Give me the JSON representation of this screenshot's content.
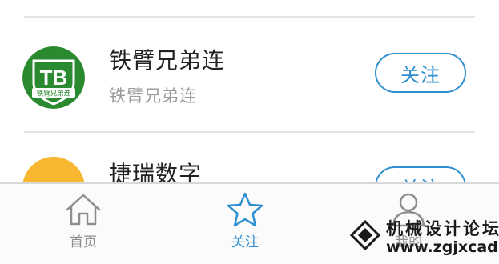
{
  "accounts": [
    {
      "name": "铁臂兄弟连",
      "subtitle": "铁臂兄弟连",
      "follow_label": "关注",
      "avatar": {
        "badge_text": "TB",
        "ribbon_text": "铁臂兄弟连",
        "bg_color": "#2a8a2f"
      }
    },
    {
      "name": "捷瑞数字",
      "follow_label": "关注",
      "avatar": {
        "bg_color": "#f7b731"
      }
    }
  ],
  "tabbar": {
    "tabs": [
      {
        "label": "首页",
        "icon": "home-icon",
        "active": false
      },
      {
        "label": "关注",
        "icon": "star-icon",
        "active": true
      },
      {
        "label": "我的",
        "icon": "profile-icon",
        "active": false
      }
    ]
  },
  "colors": {
    "accent": "#2f8fd0",
    "inactive": "#8e8e8e",
    "divider": "#e5e5e5"
  },
  "watermark": {
    "title": "机械设计论坛",
    "url": "www.zgjxcad.com"
  }
}
